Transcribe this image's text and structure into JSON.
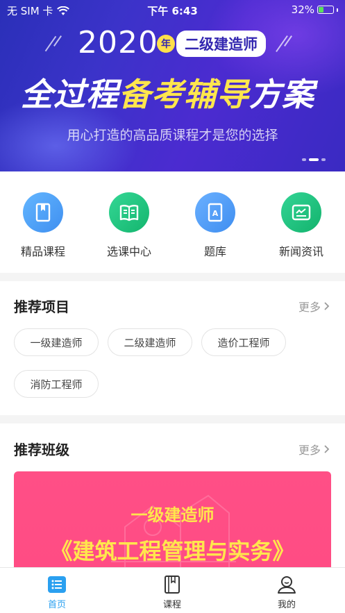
{
  "status_bar": {
    "carrier": "无 SIM 卡",
    "time": "下午 6:43",
    "battery": "32%"
  },
  "banner": {
    "year": "2020",
    "year_suffix": "年",
    "exam_tag": "二级建造师",
    "headline_part1": "全过程",
    "headline_part2": "备考辅导",
    "headline_part3": "方案",
    "subtitle": "用心打造的高品质课程才是您的选择",
    "page_count": 3,
    "active_page": 2
  },
  "menu": {
    "items": [
      {
        "label": "精品课程",
        "icon": "bookmark-book-icon",
        "color": "#4aa3f7"
      },
      {
        "label": "选课中心",
        "icon": "open-book-icon",
        "color": "#22c47f"
      },
      {
        "label": "题库",
        "icon": "question-bank-icon",
        "color": "#4f9bf2"
      },
      {
        "label": "新闻资讯",
        "icon": "news-icon",
        "color": "#20c382"
      }
    ]
  },
  "recommend_projects": {
    "title": "推荐项目",
    "more": "更多",
    "chips": [
      "一级建造师",
      "二级建造师",
      "造价工程师",
      "消防工程师"
    ]
  },
  "recommend_classes": {
    "title": "推荐班级",
    "more": "更多",
    "card": {
      "line1": "一级建造师",
      "line2": "《建筑工程管理与实务》",
      "bg_color": "#ff4f86",
      "text_color": "#ffe64d"
    }
  },
  "tabbar": {
    "tabs": [
      {
        "label": "首页",
        "icon": "home-list-icon",
        "active": true
      },
      {
        "label": "课程",
        "icon": "course-book-icon",
        "active": false
      },
      {
        "label": "我的",
        "icon": "profile-icon",
        "active": false
      }
    ],
    "active_color": "#2aa0f0"
  }
}
